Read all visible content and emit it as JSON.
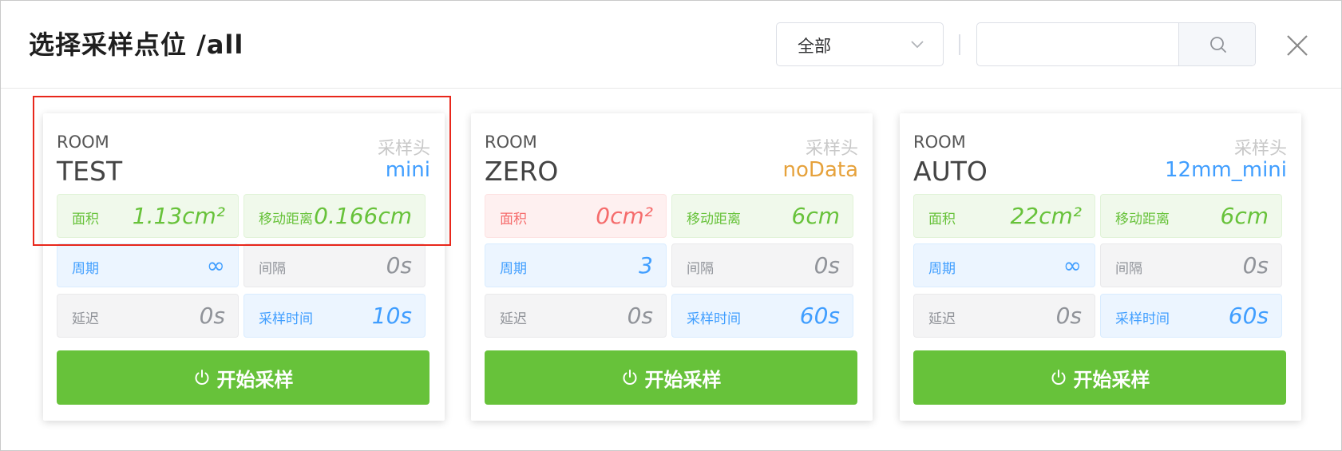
{
  "header": {
    "title": "选择采样点位 /all",
    "filter_value": "全部",
    "search_placeholder": ""
  },
  "cards": [
    {
      "room_label": "ROOM",
      "room_name": "TEST",
      "head_label": "采样头",
      "head_value": "mini",
      "head_color": "#409eff",
      "area_label": "面积",
      "area_value": "1.13cm²",
      "move_label": "移动距离",
      "move_value": "0.166cm",
      "period_label": "周期",
      "period_value": "∞",
      "interval_label": "间隔",
      "interval_value": "0s",
      "delay_label": "延迟",
      "delay_value": "0s",
      "sample_time_label": "采样时间",
      "sample_time_value": "10s",
      "start_label": "开始采样"
    },
    {
      "room_label": "ROOM",
      "room_name": "ZERO",
      "head_label": "采样头",
      "head_value": "noData",
      "head_color": "#e6a23c",
      "area_label": "面积",
      "area_value": "0cm²",
      "move_label": "移动距离",
      "move_value": "6cm",
      "period_label": "周期",
      "period_value": "3",
      "interval_label": "间隔",
      "interval_value": "0s",
      "delay_label": "延迟",
      "delay_value": "0s",
      "sample_time_label": "采样时间",
      "sample_time_value": "60s",
      "start_label": "开始采样"
    },
    {
      "room_label": "ROOM",
      "room_name": "AUTO",
      "head_label": "采样头",
      "head_value": "12mm_mini",
      "head_color": "#409eff",
      "area_label": "面积",
      "area_value": "22cm²",
      "move_label": "移动距离",
      "move_value": "6cm",
      "period_label": "周期",
      "period_value": "∞",
      "interval_label": "间隔",
      "interval_value": "0s",
      "delay_label": "延迟",
      "delay_value": "0s",
      "sample_time_label": "采样时间",
      "sample_time_value": "60s",
      "start_label": "开始采样"
    }
  ],
  "colors": {
    "success": "#67c23a",
    "danger": "#f56c6c",
    "primary": "#409eff",
    "warning": "#e6a23c",
    "info": "#909399",
    "highlight_border": "#e8271b"
  },
  "icons": {
    "select_arrow": "chevron-down-icon",
    "search": "search-icon",
    "close": "close-icon",
    "start": "power-icon"
  }
}
